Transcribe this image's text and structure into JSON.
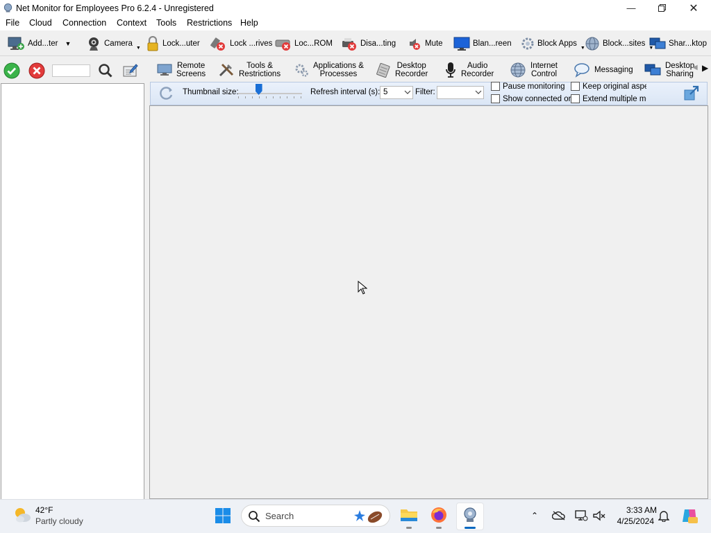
{
  "window": {
    "title": "Net Monitor for Employees Pro 6.2.4 - Unregistered"
  },
  "menu": [
    "File",
    "Cloud",
    "Connection",
    "Context",
    "Tools",
    "Restrictions",
    "Help"
  ],
  "toolbar": {
    "add_computer": "Add...ter",
    "camera": "Camera",
    "lock_computer": "Lock...uter",
    "lock_drives": "Lock ...rives",
    "lock_cdrom": "Loc...ROM",
    "disable_printing": "Disa...ting",
    "mute": "Mute",
    "blank_screen": "Blan...reen",
    "block_apps": "Block Apps",
    "block_websites": "Block...sites",
    "share_desktop": "Shar...ktop"
  },
  "left": {
    "search_value": ""
  },
  "tabs": {
    "remote_screens": [
      "Remote",
      "Screens"
    ],
    "tools_restrictions": [
      "Tools &",
      "Restrictions"
    ],
    "applications": [
      "Applications &",
      "Processes"
    ],
    "desktop_recorder": [
      "Desktop",
      "Recorder"
    ],
    "audio_recorder": [
      "Audio",
      "Recorder"
    ],
    "internet_control": [
      "Internet",
      "Control"
    ],
    "messaging": "Messaging",
    "desktop_sharing": [
      "Desktop",
      "Sharing"
    ]
  },
  "options": {
    "thumbnail_label": "Thumbnail size:",
    "thumbnail_level": 0.3,
    "refresh_label": "Refresh interval (s):",
    "refresh_value": "5",
    "filter_label": "Filter:",
    "filter_value": "",
    "pause_monitoring": "Pause monitoring",
    "show_connected": "Show connected or",
    "keep_aspect": "Keep original aspec",
    "extend_multiple": "Extend multiple mo"
  },
  "taskbar": {
    "weather_temp": "42°F",
    "weather_desc": "Partly cloudy",
    "search_placeholder": "Search",
    "time": "3:33 AM",
    "date": "4/25/2024"
  },
  "colors": {
    "accent": "#0067c0",
    "ok_green": "#3bb34a",
    "cancel_red": "#e23b3b"
  }
}
